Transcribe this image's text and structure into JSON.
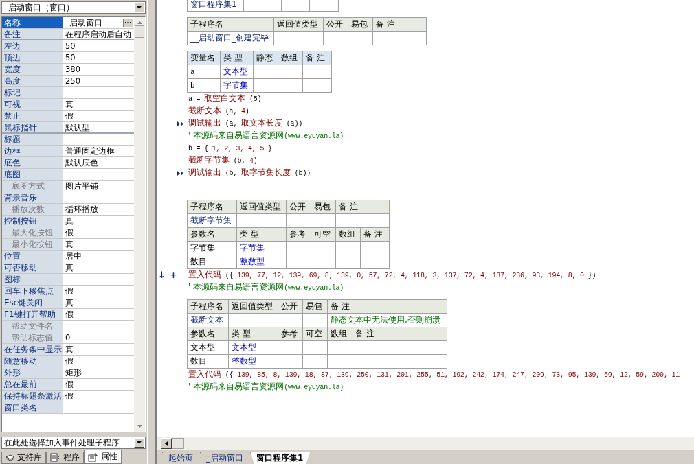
{
  "object_selector": {
    "value": "_启动窗口（窗口）"
  },
  "properties": [
    {
      "name": "名称",
      "value": "_启动窗口",
      "selected": true,
      "sub": false,
      "divider_after": false
    },
    {
      "name": "备注",
      "value": "在程序启动后自动",
      "selected": false,
      "sub": false,
      "divider_after": true
    },
    {
      "name": "左边",
      "value": "50",
      "selected": false,
      "sub": false,
      "divider_after": false
    },
    {
      "name": "顶边",
      "value": "50",
      "selected": false,
      "sub": false,
      "divider_after": false
    },
    {
      "name": "宽度",
      "value": "380",
      "selected": false,
      "sub": false,
      "divider_after": false
    },
    {
      "name": "高度",
      "value": "250",
      "selected": false,
      "sub": false,
      "divider_after": false
    },
    {
      "name": "标记",
      "selected": false,
      "sub": false,
      "divider_after": false
    },
    {
      "name": "可视",
      "value": "真",
      "selected": false,
      "sub": false,
      "divider_after": false
    },
    {
      "name": "禁止",
      "value": "假",
      "selected": false,
      "sub": false,
      "divider_after": false
    },
    {
      "name": "鼠标指针",
      "value": "默认型",
      "selected": false,
      "sub": false,
      "divider_after": true
    },
    {
      "name": "标题",
      "selected": false,
      "sub": false,
      "divider_after": false
    },
    {
      "name": "边框",
      "value": "普通固定边框",
      "selected": false,
      "sub": false,
      "divider_after": false
    },
    {
      "name": "底色",
      "value": "默认底色",
      "selected": false,
      "sub": false,
      "divider_after": false
    },
    {
      "name": "底图",
      "selected": false,
      "sub": false,
      "divider_after": false
    },
    {
      "name": "底图方式",
      "value": "图片平铺",
      "selected": false,
      "sub": true,
      "divider_after": false
    },
    {
      "name": "背景音乐",
      "selected": false,
      "sub": false,
      "divider_after": false
    },
    {
      "name": "播放次数",
      "value": "循环播放",
      "selected": false,
      "sub": true,
      "divider_after": false
    },
    {
      "name": "控制按钮",
      "value": "真",
      "selected": false,
      "sub": false,
      "divider_after": false
    },
    {
      "name": "最大化按钮",
      "value": "假",
      "selected": false,
      "sub": true,
      "divider_after": false
    },
    {
      "name": "最小化按钮",
      "value": "真",
      "selected": false,
      "sub": true,
      "divider_after": false
    },
    {
      "name": "位置",
      "value": "居中",
      "selected": false,
      "sub": false,
      "divider_after": false
    },
    {
      "name": "可否移动",
      "value": "真",
      "selected": false,
      "sub": false,
      "divider_after": false
    },
    {
      "name": "图标",
      "selected": false,
      "sub": false,
      "divider_after": false
    },
    {
      "name": "回车下移焦点",
      "value": "假",
      "selected": false,
      "sub": false,
      "divider_after": false
    },
    {
      "name": "Esc键关闭",
      "value": "真",
      "selected": false,
      "sub": false,
      "divider_after": false
    },
    {
      "name": "F1键打开帮助",
      "value": "假",
      "selected": false,
      "sub": false,
      "divider_after": false
    },
    {
      "name": "帮助文件名",
      "selected": false,
      "sub": true,
      "divider_after": false
    },
    {
      "name": "帮助标志值",
      "value": "0",
      "selected": false,
      "sub": true,
      "divider_after": false
    },
    {
      "name": "在任务条中显示",
      "value": "真",
      "selected": false,
      "sub": false,
      "divider_after": false
    },
    {
      "name": "随意移动",
      "value": "假",
      "selected": false,
      "sub": false,
      "divider_after": false
    },
    {
      "name": "外形",
      "value": "矩形",
      "selected": false,
      "sub": false,
      "divider_after": false
    },
    {
      "name": "总在最前",
      "value": "假",
      "selected": false,
      "sub": false,
      "divider_after": false
    },
    {
      "name": "保持标题条激活",
      "value": "假",
      "selected": false,
      "sub": false,
      "divider_after": false
    },
    {
      "name": "窗口类名",
      "selected": false,
      "sub": false,
      "divider_after": false
    }
  ],
  "event_selector": {
    "value": "在此处选择加入事件处理子程序"
  },
  "panel_tabs": [
    {
      "label": "支持库",
      "selected": false
    },
    {
      "label": "程序",
      "selected": false
    },
    {
      "label": "属性",
      "selected": true
    }
  ],
  "editor": {
    "blocks": [
      {
        "kind": "set_table",
        "rows": [
          {
            "header": false,
            "cells": [
              {
                "text": "窗口程序集1",
                "kind": "name"
              },
              null,
              null,
              null
            ]
          }
        ]
      },
      {
        "kind": "sub_table",
        "rows": [
          {
            "header": true,
            "cells": [
              {
                "text": "子程序名",
                "kind": "plain"
              },
              {
                "text": "返回值类型",
                "kind": "plain"
              },
              {
                "text": "公开",
                "kind": "plain"
              },
              {
                "text": "易包",
                "kind": "plain"
              },
              {
                "text": "备 注",
                "kind": "plain"
              }
            ]
          },
          {
            "header": false,
            "cells": [
              {
                "text": "__启动窗口_创建完毕",
                "kind": "name"
              },
              null,
              null,
              null,
              null
            ]
          }
        ]
      },
      {
        "kind": "var_table",
        "rows": [
          {
            "header": true,
            "cells": [
              {
                "text": "变量名",
                "kind": "plain"
              },
              {
                "text": "类 型",
                "kind": "plain"
              },
              {
                "text": "静态",
                "kind": "plain"
              },
              {
                "text": "数组",
                "kind": "plain"
              },
              {
                "text": "备 注",
                "kind": "plain"
              }
            ]
          },
          {
            "header": false,
            "cells": [
              {
                "text": "a",
                "kind": "ascii"
              },
              {
                "text": "文本型",
                "kind": "type"
              },
              null,
              null,
              null
            ]
          },
          {
            "header": false,
            "cells": [
              {
                "text": "b",
                "kind": "ascii"
              },
              {
                "text": "字节集",
                "kind": "type"
              },
              null,
              null,
              null
            ]
          }
        ]
      },
      {
        "kind": "line",
        "segments": [
          {
            "text": "a = ",
            "kind": "plain"
          },
          {
            "text": "取空白文本",
            "kind": "func"
          },
          {
            "text": " (5)",
            "kind": "plain"
          }
        ]
      },
      {
        "kind": "line",
        "segments": [
          {
            "text": "截断文本",
            "kind": "func"
          },
          {
            "text": " (a, ",
            "kind": "plain"
          },
          {
            "text": "4",
            "kind": "num"
          },
          {
            "text": ")",
            "kind": "plain"
          }
        ]
      },
      {
        "kind": "debug_line",
        "segments": [
          {
            "text": "调试输出",
            "kind": "func"
          },
          {
            "text": " (a, ",
            "kind": "plain"
          },
          {
            "text": "取文本长度",
            "kind": "func"
          },
          {
            "text": " (a))",
            "kind": "plain"
          }
        ]
      },
      {
        "kind": "line",
        "segments": [
          {
            "text": "' 本源码来自易语言资源网",
            "kind": "comment"
          },
          {
            "text": "(www.eyuyan.la)",
            "kind": "comment"
          }
        ]
      },
      {
        "kind": "line",
        "segments": [
          {
            "text": "b = { ",
            "kind": "plain"
          },
          {
            "text": "1, 2, 3, 4, 5",
            "kind": "num"
          },
          {
            "text": " }",
            "kind": "plain"
          }
        ]
      },
      {
        "kind": "line",
        "segments": [
          {
            "text": "截断字节集",
            "kind": "func"
          },
          {
            "text": " (b, ",
            "kind": "plain"
          },
          {
            "text": "4",
            "kind": "num"
          },
          {
            "text": ")",
            "kind": "plain"
          }
        ]
      },
      {
        "kind": "debug_line",
        "segments": [
          {
            "text": "调试输出",
            "kind": "func"
          },
          {
            "text": " (b, ",
            "kind": "plain"
          },
          {
            "text": "取字节集长度",
            "kind": "func"
          },
          {
            "text": " (b))",
            "kind": "plain"
          }
        ]
      },
      {
        "kind": "blank"
      },
      {
        "kind": "sub_table",
        "rows": [
          {
            "header": true,
            "cells": [
              {
                "text": "子程序名",
                "kind": "plain"
              },
              {
                "text": "返回值类型",
                "kind": "plain"
              },
              {
                "text": "公开",
                "kind": "plain"
              },
              {
                "text": "易包",
                "kind": "plain"
              },
              {
                "text": "备 注",
                "kind": "plain",
                "colspan": 2
              }
            ]
          },
          {
            "header": false,
            "cells": [
              {
                "text": "截断字节集",
                "kind": "name"
              },
              null,
              null,
              null,
              {
                "colspan": 2
              }
            ]
          },
          {
            "header": true,
            "cells": [
              {
                "text": "参数名",
                "kind": "plain"
              },
              {
                "text": "类 型",
                "kind": "plain"
              },
              {
                "text": "参考",
                "kind": "plain"
              },
              {
                "text": "可空",
                "kind": "plain"
              },
              {
                "text": "数组",
                "kind": "plain"
              },
              {
                "text": "备 注",
                "kind": "plain"
              }
            ]
          },
          {
            "header": false,
            "cells": [
              {
                "text": "字节集",
                "kind": "plain"
              },
              {
                "text": "字节集",
                "kind": "type"
              },
              null,
              null,
              null,
              null
            ]
          },
          {
            "header": false,
            "cells": [
              {
                "text": "数目",
                "kind": "plain"
              },
              {
                "text": "整数型",
                "kind": "type"
              },
              null,
              null,
              null,
              null
            ]
          }
        ]
      },
      {
        "kind": "insert_line",
        "gutter": [
          "↓",
          "+"
        ],
        "segments": [
          {
            "text": "置入代码",
            "kind": "func"
          },
          {
            "text": " ({ ",
            "kind": "plain"
          },
          {
            "text": "139, 77, 12, 139, 69, 8, 139, 0, 57, 72, 4, 118, 3, 137, 72, 4, 137, 236, 93, 194, 8, 0",
            "kind": "num"
          },
          {
            "text": " })",
            "kind": "plain"
          }
        ]
      },
      {
        "kind": "line",
        "segments": [
          {
            "text": "' 本源码来自易语言资源网",
            "kind": "comment"
          },
          {
            "text": "(www.eyuyan.la)",
            "kind": "comment"
          }
        ]
      },
      {
        "kind": "sub_table",
        "rows": [
          {
            "header": true,
            "cells": [
              {
                "text": "子程序名",
                "kind": "plain"
              },
              {
                "text": "返回值类型",
                "kind": "plain"
              },
              {
                "text": "公开",
                "kind": "plain"
              },
              {
                "text": "易包",
                "kind": "plain"
              },
              {
                "text": "备 注",
                "kind": "plain",
                "colspan": 2
              }
            ]
          },
          {
            "header": false,
            "cells": [
              {
                "text": "截断文本",
                "kind": "name"
              },
              null,
              null,
              null,
              {
                "text": "静态文本中无法使用,否则崩溃",
                "kind": "note",
                "colspan": 2
              }
            ]
          },
          {
            "header": true,
            "cells": [
              {
                "text": "参数名",
                "kind": "plain"
              },
              {
                "text": "类 型",
                "kind": "plain"
              },
              {
                "text": "参考",
                "kind": "plain"
              },
              {
                "text": "可空",
                "kind": "plain"
              },
              {
                "text": "数组",
                "kind": "plain"
              },
              {
                "text": "备 注",
                "kind": "plain"
              }
            ]
          },
          {
            "header": false,
            "cells": [
              {
                "text": "文本型",
                "kind": "plain"
              },
              {
                "text": "文本型",
                "kind": "type"
              },
              null,
              null,
              null,
              null
            ]
          },
          {
            "header": false,
            "cells": [
              {
                "text": "数目",
                "kind": "plain"
              },
              {
                "text": "整数型",
                "kind": "type"
              },
              null,
              null,
              null,
              null
            ]
          }
        ]
      },
      {
        "kind": "line",
        "segments": [
          {
            "text": "置入代码",
            "kind": "func"
          },
          {
            "text": " ({ ",
            "kind": "plain"
          },
          {
            "text": "139, 85, 8, 139, 18, 87, 139, 250, 131, 201, 255, 51, 192, 242, 174, 247, 209, 73, 95, 139, 69, 12, 59, 200, 11",
            "kind": "num"
          }
        ]
      },
      {
        "kind": "line",
        "segments": [
          {
            "text": "' 本源码来自易语言资源网",
            "kind": "comment"
          },
          {
            "text": "(www.eyuyan.la)",
            "kind": "comment"
          }
        ]
      }
    ]
  },
  "editor_tabs": [
    {
      "label": "起始页",
      "selected": false
    },
    {
      "label": "_启动窗口",
      "selected": false
    },
    {
      "label": "窗口程序集1",
      "selected": true
    }
  ]
}
